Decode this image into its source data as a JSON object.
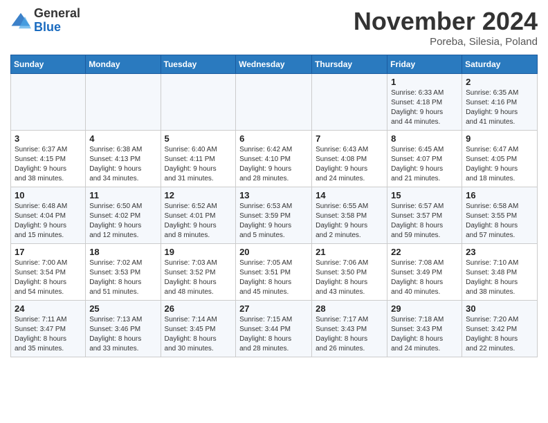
{
  "logo": {
    "general": "General",
    "blue": "Blue"
  },
  "title": "November 2024",
  "location": "Poreba, Silesia, Poland",
  "days_of_week": [
    "Sunday",
    "Monday",
    "Tuesday",
    "Wednesday",
    "Thursday",
    "Friday",
    "Saturday"
  ],
  "weeks": [
    [
      {
        "day": "",
        "info": ""
      },
      {
        "day": "",
        "info": ""
      },
      {
        "day": "",
        "info": ""
      },
      {
        "day": "",
        "info": ""
      },
      {
        "day": "",
        "info": ""
      },
      {
        "day": "1",
        "info": "Sunrise: 6:33 AM\nSunset: 4:18 PM\nDaylight: 9 hours\nand 44 minutes."
      },
      {
        "day": "2",
        "info": "Sunrise: 6:35 AM\nSunset: 4:16 PM\nDaylight: 9 hours\nand 41 minutes."
      }
    ],
    [
      {
        "day": "3",
        "info": "Sunrise: 6:37 AM\nSunset: 4:15 PM\nDaylight: 9 hours\nand 38 minutes."
      },
      {
        "day": "4",
        "info": "Sunrise: 6:38 AM\nSunset: 4:13 PM\nDaylight: 9 hours\nand 34 minutes."
      },
      {
        "day": "5",
        "info": "Sunrise: 6:40 AM\nSunset: 4:11 PM\nDaylight: 9 hours\nand 31 minutes."
      },
      {
        "day": "6",
        "info": "Sunrise: 6:42 AM\nSunset: 4:10 PM\nDaylight: 9 hours\nand 28 minutes."
      },
      {
        "day": "7",
        "info": "Sunrise: 6:43 AM\nSunset: 4:08 PM\nDaylight: 9 hours\nand 24 minutes."
      },
      {
        "day": "8",
        "info": "Sunrise: 6:45 AM\nSunset: 4:07 PM\nDaylight: 9 hours\nand 21 minutes."
      },
      {
        "day": "9",
        "info": "Sunrise: 6:47 AM\nSunset: 4:05 PM\nDaylight: 9 hours\nand 18 minutes."
      }
    ],
    [
      {
        "day": "10",
        "info": "Sunrise: 6:48 AM\nSunset: 4:04 PM\nDaylight: 9 hours\nand 15 minutes."
      },
      {
        "day": "11",
        "info": "Sunrise: 6:50 AM\nSunset: 4:02 PM\nDaylight: 9 hours\nand 12 minutes."
      },
      {
        "day": "12",
        "info": "Sunrise: 6:52 AM\nSunset: 4:01 PM\nDaylight: 9 hours\nand 8 minutes."
      },
      {
        "day": "13",
        "info": "Sunrise: 6:53 AM\nSunset: 3:59 PM\nDaylight: 9 hours\nand 5 minutes."
      },
      {
        "day": "14",
        "info": "Sunrise: 6:55 AM\nSunset: 3:58 PM\nDaylight: 9 hours\nand 2 minutes."
      },
      {
        "day": "15",
        "info": "Sunrise: 6:57 AM\nSunset: 3:57 PM\nDaylight: 8 hours\nand 59 minutes."
      },
      {
        "day": "16",
        "info": "Sunrise: 6:58 AM\nSunset: 3:55 PM\nDaylight: 8 hours\nand 57 minutes."
      }
    ],
    [
      {
        "day": "17",
        "info": "Sunrise: 7:00 AM\nSunset: 3:54 PM\nDaylight: 8 hours\nand 54 minutes."
      },
      {
        "day": "18",
        "info": "Sunrise: 7:02 AM\nSunset: 3:53 PM\nDaylight: 8 hours\nand 51 minutes."
      },
      {
        "day": "19",
        "info": "Sunrise: 7:03 AM\nSunset: 3:52 PM\nDaylight: 8 hours\nand 48 minutes."
      },
      {
        "day": "20",
        "info": "Sunrise: 7:05 AM\nSunset: 3:51 PM\nDaylight: 8 hours\nand 45 minutes."
      },
      {
        "day": "21",
        "info": "Sunrise: 7:06 AM\nSunset: 3:50 PM\nDaylight: 8 hours\nand 43 minutes."
      },
      {
        "day": "22",
        "info": "Sunrise: 7:08 AM\nSunset: 3:49 PM\nDaylight: 8 hours\nand 40 minutes."
      },
      {
        "day": "23",
        "info": "Sunrise: 7:10 AM\nSunset: 3:48 PM\nDaylight: 8 hours\nand 38 minutes."
      }
    ],
    [
      {
        "day": "24",
        "info": "Sunrise: 7:11 AM\nSunset: 3:47 PM\nDaylight: 8 hours\nand 35 minutes."
      },
      {
        "day": "25",
        "info": "Sunrise: 7:13 AM\nSunset: 3:46 PM\nDaylight: 8 hours\nand 33 minutes."
      },
      {
        "day": "26",
        "info": "Sunrise: 7:14 AM\nSunset: 3:45 PM\nDaylight: 8 hours\nand 30 minutes."
      },
      {
        "day": "27",
        "info": "Sunrise: 7:15 AM\nSunset: 3:44 PM\nDaylight: 8 hours\nand 28 minutes."
      },
      {
        "day": "28",
        "info": "Sunrise: 7:17 AM\nSunset: 3:43 PM\nDaylight: 8 hours\nand 26 minutes."
      },
      {
        "day": "29",
        "info": "Sunrise: 7:18 AM\nSunset: 3:43 PM\nDaylight: 8 hours\nand 24 minutes."
      },
      {
        "day": "30",
        "info": "Sunrise: 7:20 AM\nSunset: 3:42 PM\nDaylight: 8 hours\nand 22 minutes."
      }
    ]
  ]
}
